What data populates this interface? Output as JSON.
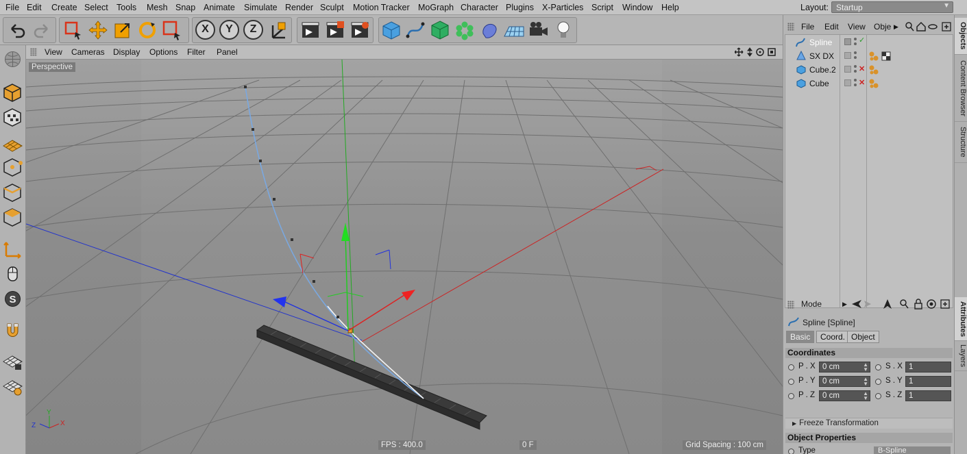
{
  "menu": [
    "File",
    "Edit",
    "Create",
    "Select",
    "Tools",
    "Mesh",
    "Snap",
    "Animate",
    "Simulate",
    "Render",
    "Sculpt",
    "Motion Tracker",
    "MoGraph",
    "Character",
    "Plugins",
    "X-Particles",
    "Script",
    "Window",
    "Help"
  ],
  "layout": {
    "label": "Layout:",
    "value": "Startup"
  },
  "toolbar": {
    "x_label": "X",
    "y_label": "Y",
    "z_label": "Z"
  },
  "viewport": {
    "menu": [
      "View",
      "Cameras",
      "Display",
      "Options",
      "Filter",
      "Panel"
    ],
    "camera_label": "Perspective",
    "fps": "FPS : 400.0",
    "frame": "0 F",
    "grid_spacing": "Grid Spacing : 100 cm",
    "axis_x": "X",
    "axis_y": "Y",
    "axis_z": "Z"
  },
  "objects_panel": {
    "menu": [
      "File",
      "Edit",
      "View",
      "Obje"
    ],
    "items": [
      {
        "name": "Spline",
        "selected": true
      },
      {
        "name": "SX DX",
        "selected": false
      },
      {
        "name": "Cube.2",
        "selected": false
      },
      {
        "name": "Cube",
        "selected": false
      }
    ]
  },
  "attributes": {
    "mode_label": "Mode",
    "title": "Spline [Spline]",
    "tabs": [
      "Basic",
      "Coord.",
      "Object"
    ],
    "active_tab": "Basic",
    "section_coordinates": "Coordinates",
    "rows": [
      {
        "p_label": "P . X",
        "p_value": "0 cm",
        "s_label": "S . X",
        "s_value": "1"
      },
      {
        "p_label": "P . Y",
        "p_value": "0 cm",
        "s_label": "S . Y",
        "s_value": "1"
      },
      {
        "p_label": "P . Z",
        "p_value": "0 cm",
        "s_label": "S . Z",
        "s_value": "1"
      }
    ],
    "freeze": "Freeze Transformation",
    "section_object": "Object Properties",
    "type_label": "Type",
    "type_value": "B-Spline"
  },
  "side_tabs": [
    "Objects",
    "Content Browser",
    "Structure",
    "Attributes",
    "Layers"
  ],
  "colors": {
    "accent_blue": "#3b82c8",
    "x_axis": "#cc2222",
    "y_axis": "#22aa22",
    "z_axis": "#2233cc"
  }
}
